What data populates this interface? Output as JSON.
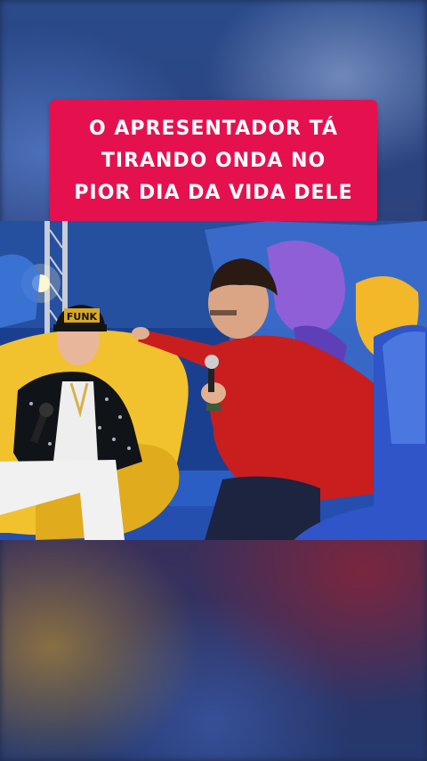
{
  "caption": {
    "lines": [
      "O APRESENTADOR TÁ",
      "TIRANDO ONDA NO",
      "PIOR DIA DA VIDA DELE"
    ]
  },
  "video": {
    "cap_text": "FUNK"
  },
  "colors": {
    "caption_bg": "#e5114f",
    "chair_yellow": "#f2c12e",
    "host_shirt": "#c81e1e",
    "stage_blue": "#1b3f8f"
  }
}
